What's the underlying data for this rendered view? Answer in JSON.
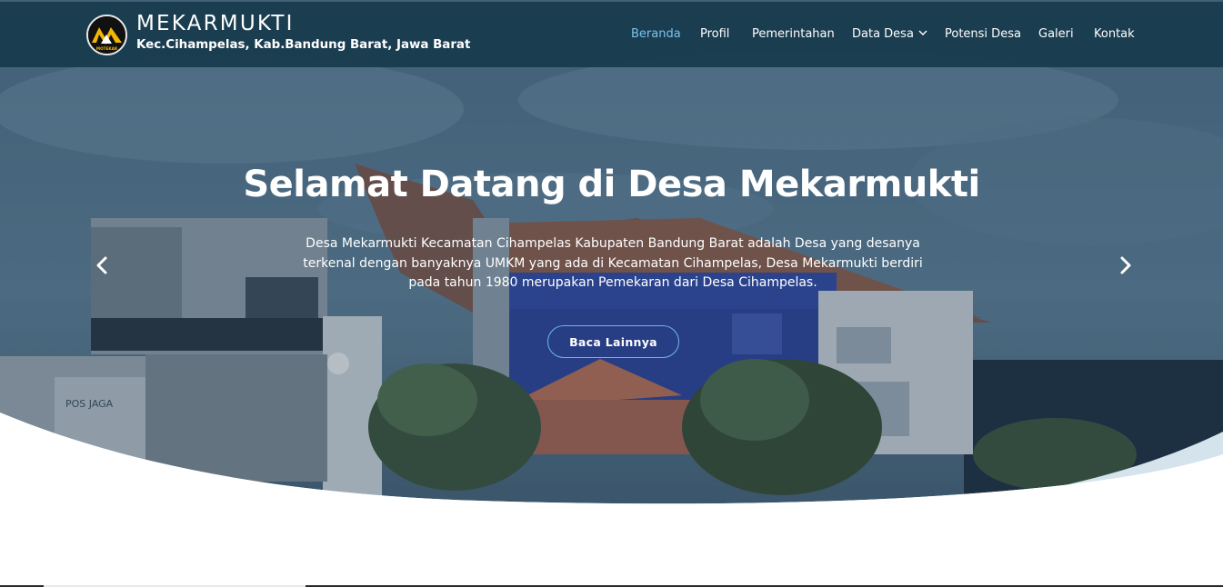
{
  "header": {
    "brand_title": "MEKARMUKTI",
    "brand_subtitle": "Kec.Cihampelas, Kab.Bandung Barat, Jawa Barat",
    "logo_text": "MOTEKAR",
    "background_color": "#183a4e"
  },
  "nav": {
    "items": [
      {
        "label": "Beranda",
        "active": true
      },
      {
        "label": "Profil"
      },
      {
        "label": "Pemerintahan"
      },
      {
        "label": "Data Desa",
        "dropdown": true
      },
      {
        "label": "Potensi Desa"
      },
      {
        "label": "Galeri"
      },
      {
        "label": "Kontak"
      }
    ],
    "active_color": "#7cc4ec"
  },
  "hero": {
    "title": "Selamat Datang di Desa Mekarmukti",
    "description": "Desa Mekarmukti Kecamatan Cihampelas Kabupaten Bandung Barat adalah Desa yang desanya terkenal dengan banyaknya UMKM yang ada di Kecamatan Cihampelas, Desa Mekarmukti berdiri pada tahun 1980 merupakan Pemekaran dari Desa Cihampelas.",
    "cta_label": "Baca Lainnya",
    "building_sign": "POS JAGA",
    "prev_icon": "chevron-left-icon",
    "next_icon": "chevron-right-icon"
  },
  "colors": {
    "wave": "#d5e4ec",
    "cta_border": "#6fb6df"
  }
}
